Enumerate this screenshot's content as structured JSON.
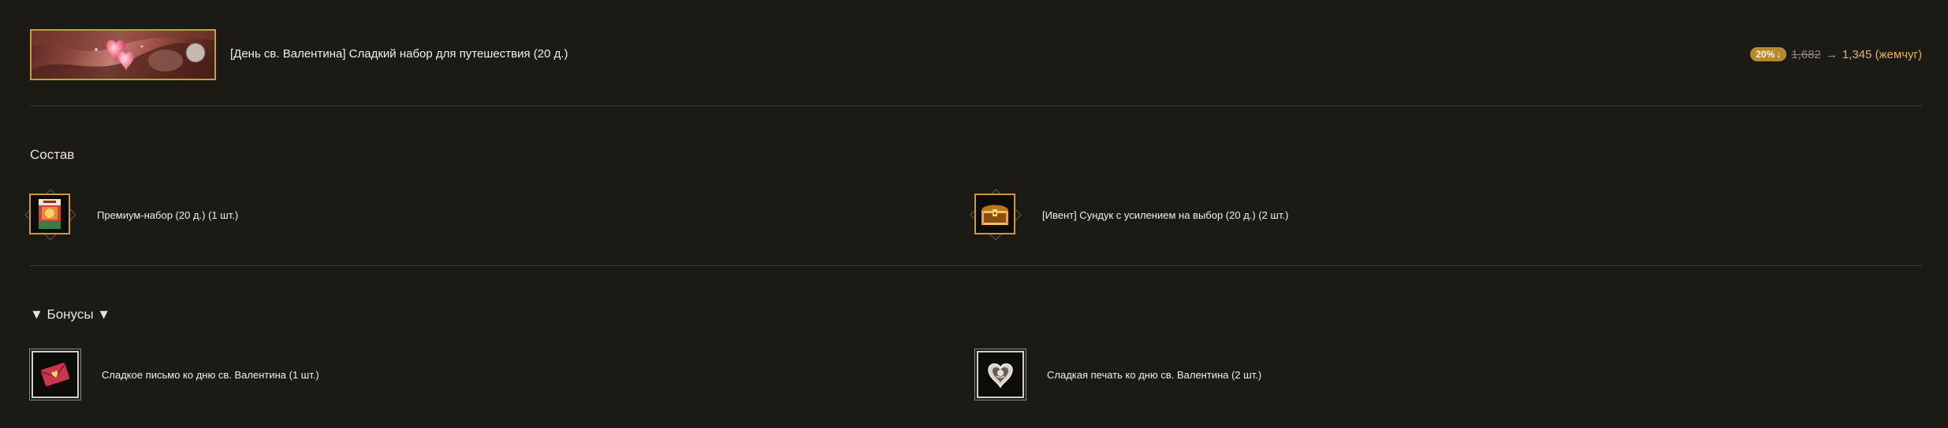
{
  "product": {
    "title": "[День св. Валентина] Сладкий набор для путешествия (20 д.)",
    "discount": "20%",
    "discount_arrow": "↓",
    "old_price": "1,682",
    "price_arrow": "→",
    "new_price": "1,345 (жемчуг)"
  },
  "composition": {
    "title": "Состав",
    "items": [
      {
        "label": "Премиум-набор (20 д.) (1 шт.)",
        "icon": "premium-pack-icon"
      },
      {
        "label": "[Ивент] Сундук с усилением на выбор (20 д.) (2 шт.)",
        "icon": "treasure-chest-icon"
      }
    ]
  },
  "bonuses": {
    "title": "▼ Бонусы ▼",
    "items": [
      {
        "label": "Сладкое письмо ко дню св. Валентина (1 шт.)",
        "icon": "valentine-letter-icon"
      },
      {
        "label": "Сладкая печать ко дню св. Валентина (2 шт.)",
        "icon": "heart-seal-icon"
      }
    ]
  },
  "colors": {
    "background": "#1b1a14",
    "gold_border": "#c99a3e",
    "price": "#e5b25a",
    "badge": "#b58a2e"
  }
}
